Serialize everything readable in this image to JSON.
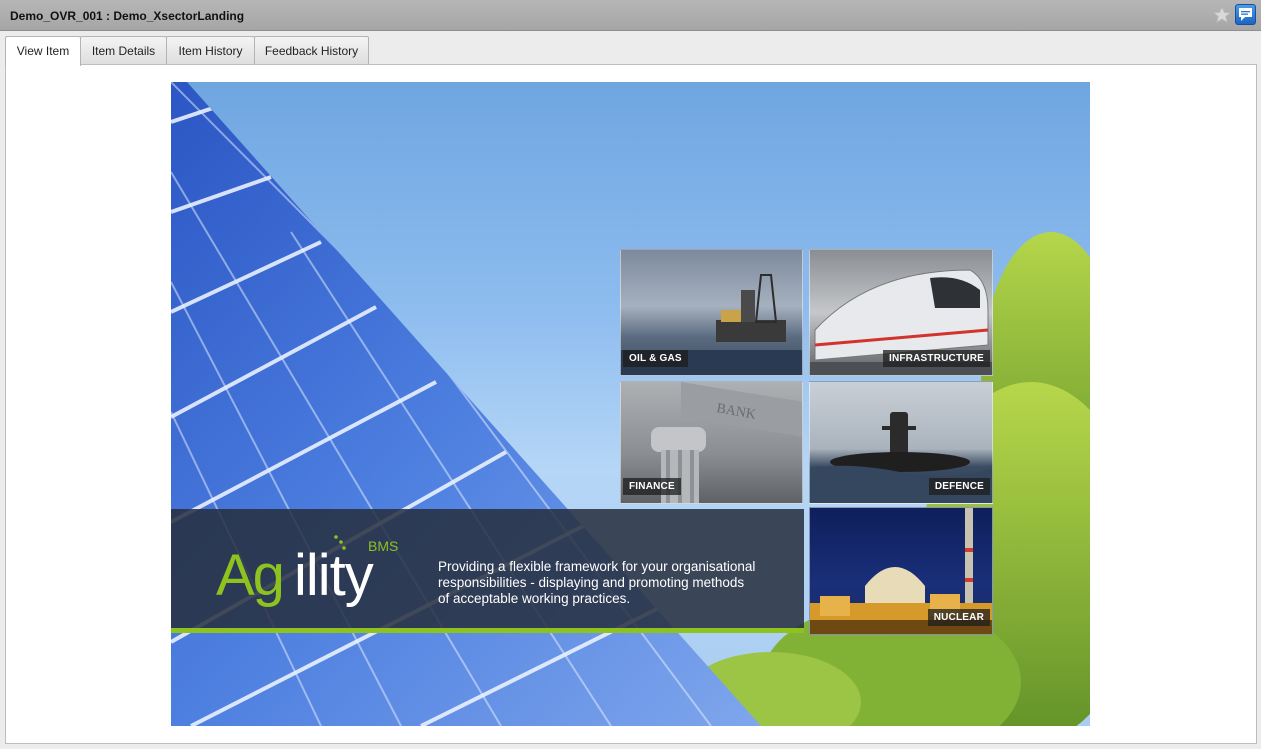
{
  "window": {
    "title": "Demo_OVR_001 : Demo_XsectorLanding",
    "icons": {
      "favorite": "star-icon",
      "feedback": "feedback-icon"
    }
  },
  "tabs": [
    {
      "label": "View Item",
      "active": true
    },
    {
      "label": "Item Details",
      "active": false
    },
    {
      "label": "Item History",
      "active": false
    },
    {
      "label": "Feedback History",
      "active": false
    }
  ],
  "landing": {
    "logo": {
      "main": "Agility",
      "suffix": "BMS"
    },
    "tagline": [
      "Providing a flexible framework for your organisational",
      "responsibilities -  displaying and promoting methods",
      "of acceptable working practices."
    ],
    "sectors": [
      {
        "label": "OIL & GAS"
      },
      {
        "label": "INFRASTRUCTURE"
      },
      {
        "label": "FINANCE"
      },
      {
        "label": "DEFENCE"
      },
      {
        "label": "NUCLEAR"
      }
    ],
    "colors": {
      "accent_green": "#8dc21f",
      "banner": "#262e3e",
      "sky": "#8dbcef"
    }
  }
}
